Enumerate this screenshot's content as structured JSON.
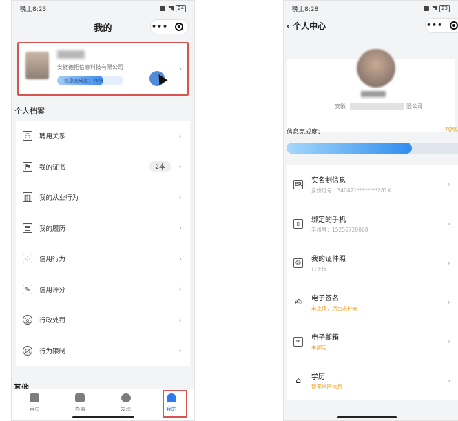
{
  "left": {
    "status": {
      "time": "晚上8:23",
      "battery": "24"
    },
    "nav": {
      "title": "我的"
    },
    "profile": {
      "company": "安徽德拓信息科技有限公司",
      "completion_text": "信息完成度：70%",
      "completion_fraction": 0.7
    },
    "section_title": "个人档案",
    "menu": [
      {
        "label": "聘用关系",
        "icon": "handshake-icon"
      },
      {
        "label": "我的证书",
        "icon": "certificate-icon",
        "badge": "2本"
      },
      {
        "label": "我的从业行为",
        "icon": "chart-icon"
      },
      {
        "label": "我的履历",
        "icon": "resume-icon"
      },
      {
        "label": "信用行为",
        "icon": "shield-icon"
      },
      {
        "label": "信用评分",
        "icon": "score-icon"
      },
      {
        "label": "行政处罚",
        "icon": "penalty-icon"
      },
      {
        "label": "行为限制",
        "icon": "restrict-icon"
      }
    ],
    "other_title": "其他",
    "tabs": [
      {
        "label": "首页",
        "icon": "home-icon"
      },
      {
        "label": "办事",
        "icon": "clipboard-icon"
      },
      {
        "label": "发现",
        "icon": "compass-icon"
      },
      {
        "label": "我的",
        "icon": "user-icon"
      }
    ]
  },
  "right": {
    "status": {
      "time": "晚上8:28",
      "battery": "23"
    },
    "nav": {
      "title": "个人中心"
    },
    "profile": {
      "company_prefix": "安徽",
      "company_suffix": "限公司"
    },
    "completion_label": "信息完成度：",
    "completion_pct": "70%",
    "completion_fraction": 0.7,
    "items": [
      {
        "title": "实名制信息",
        "sub": "身份证号：340421********281X",
        "warn": false,
        "icon": "id-card-icon"
      },
      {
        "title": "绑定的手机",
        "sub": "手机号：15256720068",
        "warn": false,
        "icon": "phone-icon"
      },
      {
        "title": "我的证件照",
        "sub": "已上传",
        "warn": false,
        "icon": "photo-icon"
      },
      {
        "title": "电子签名",
        "sub": "未上传，点击去补充",
        "warn": true,
        "icon": "signature-icon"
      },
      {
        "title": "电子邮箱",
        "sub": "未绑定",
        "warn": true,
        "icon": "mail-icon"
      },
      {
        "title": "学历",
        "sub": "暂无学历信息",
        "warn": true,
        "icon": "graduation-icon"
      }
    ]
  },
  "colors": {
    "accent": "#2b7bea",
    "highlight": "#d9534f",
    "warn": "#f0a020"
  }
}
